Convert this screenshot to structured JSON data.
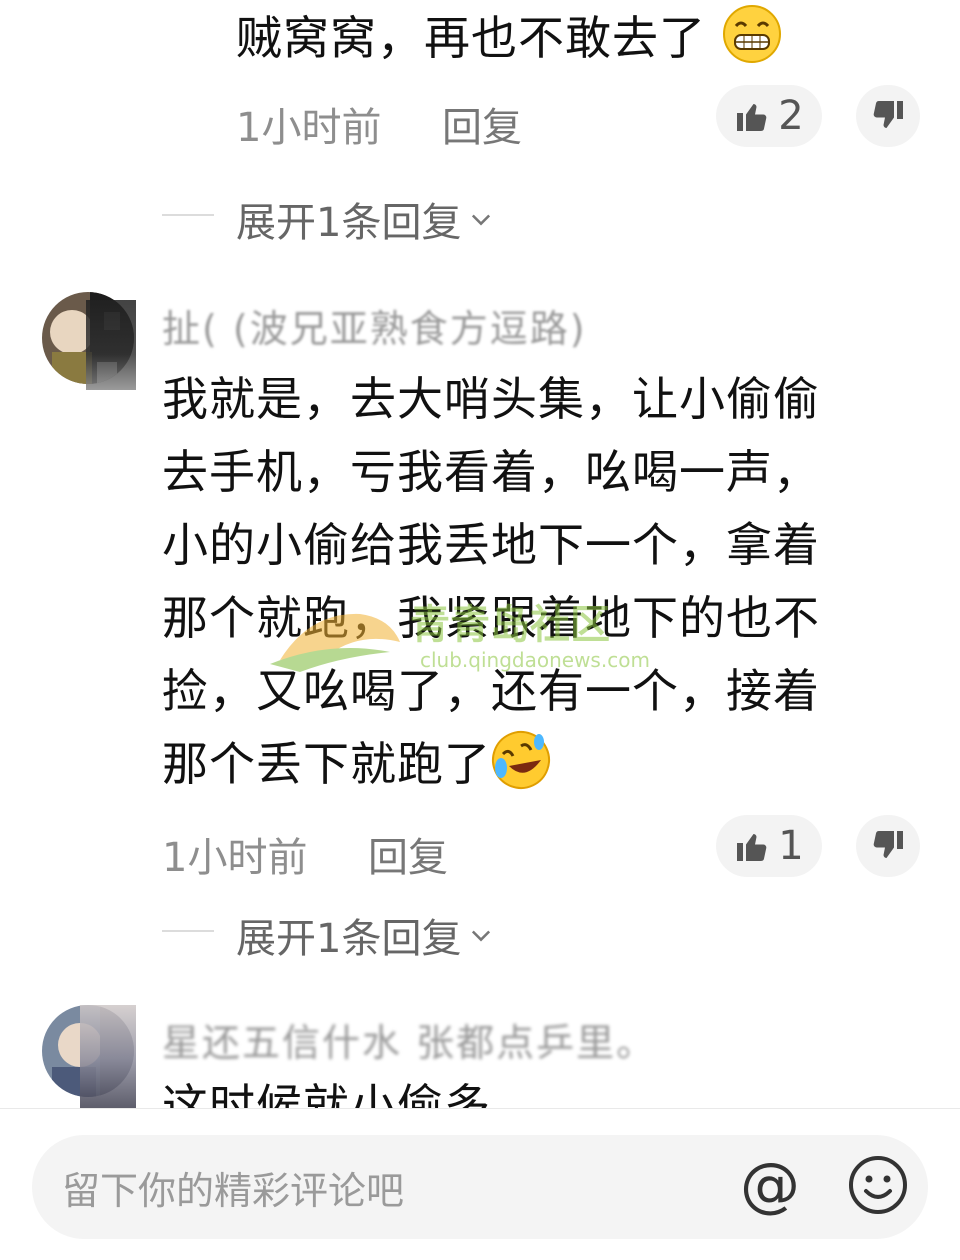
{
  "comment1": {
    "text_tail": "贼窝窝，再也不敢去了",
    "emoji": "grinning-face-icon",
    "time": "1小时前",
    "reply": "回复",
    "likes": "2",
    "expand": "展开1条回复"
  },
  "comment2": {
    "username": "扯( (波兄亚熟食方逗路)",
    "lines": [
      "我就是，去大哨头集，让小偷偷",
      "去手机，亏我看着，吆喝一声，",
      "小的小偷给我丢地下一个，拿着",
      "那个就跑，我紧跟着地下的也不",
      "捡，又吆喝了，还有一个，接着",
      "那个丢下就跑了"
    ],
    "emoji": "rolling-on-floor-laughing-icon",
    "time": "1小时前",
    "reply": "回复",
    "likes": "1",
    "expand": "展开1条回复"
  },
  "comment3": {
    "username_partial": "星还五信什水 张都点乒里。",
    "text_partial": "这时候就小偷多"
  },
  "watermark": {
    "site": "club.qingdaonews.com",
    "label": "青青岛社区"
  },
  "bottom_bar": {
    "placeholder": "留下你的精彩评论吧",
    "at_symbol": "@"
  }
}
